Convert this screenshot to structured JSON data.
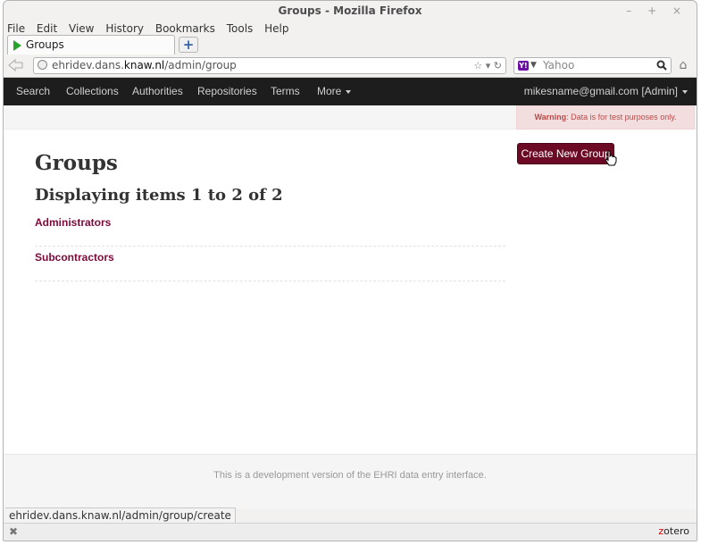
{
  "window": {
    "title": "Groups - Mozilla Firefox",
    "controls": "– + ×"
  },
  "menubar": {
    "items": [
      "File",
      "Edit",
      "View",
      "History",
      "Bookmarks",
      "Tools",
      "Help"
    ]
  },
  "tab": {
    "label": "Groups",
    "new_tab": "+"
  },
  "navbar": {
    "url_prefix": "ehridev.dans.",
    "url_domain": "knaw.nl",
    "url_path": "/admin/group",
    "search_placeholder": "Yahoo",
    "search_engine_icon": "Y!"
  },
  "sitenav": {
    "items": [
      "Search",
      "Collections",
      "Authorities",
      "Repositories",
      "Terms",
      "More"
    ],
    "user": "mikesname@gmail.com [Admin]"
  },
  "warning": {
    "label": "Warning",
    "text": ": Data is for test purposes only."
  },
  "main": {
    "create_button": "Create New Group",
    "title": "Groups",
    "subtitle": "Displaying items 1 to 2 of 2",
    "groups": [
      "Administrators",
      "Subcontractors"
    ]
  },
  "footer": {
    "text": "This is a development version of the EHRI data entry interface."
  },
  "statusbar": {
    "link": "ehridev.dans.knaw.nl/admin/group/create"
  },
  "addonbar": {
    "close": "✖",
    "zotero_z": "z",
    "zotero_rest": "otero"
  },
  "colors": {
    "accent": "#6c0a26",
    "link": "#7a0b3b",
    "nav_bg": "#1d1d1d",
    "warning_bg": "#f2dede"
  }
}
